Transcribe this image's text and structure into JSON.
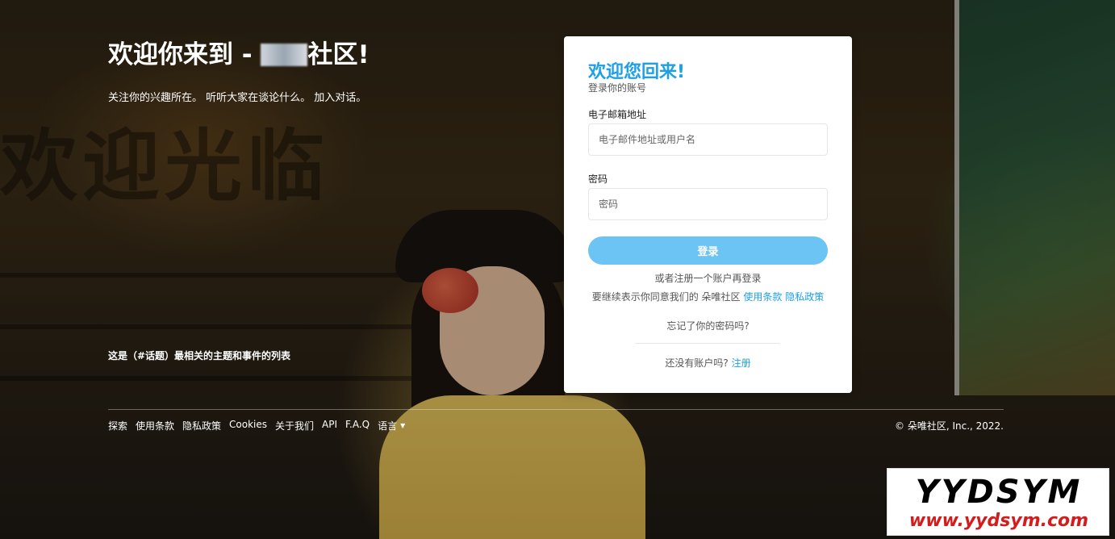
{
  "hero": {
    "title_prefix": "欢迎你来到 - ",
    "title_suffix": "社区!",
    "subtitle": "关注你的兴趣所在。 听听大家在谈论什么。 加入对话。",
    "topics": "这是（#话题）最相关的主题和事件的列表"
  },
  "background": {
    "sign_text": "欢迎光临"
  },
  "login": {
    "title": "欢迎您回来!",
    "subtitle": "登录你的账号",
    "email_label": "电子邮箱地址",
    "email_placeholder": "电子邮件地址或用户名",
    "password_label": "密码",
    "password_placeholder": "密码",
    "submit_label": "登录",
    "register_hint": "或者注册一个账户再登录",
    "terms_prefix": "要继续表示你同意我们的 朵唯社区",
    "terms_link": "使用条款",
    "privacy_link": "隐私政策",
    "forgot_password": "忘记了你的密码吗?",
    "no_account": "还没有账户吗?",
    "signup_link": "注册"
  },
  "footer": {
    "links": [
      "探索",
      "使用条款",
      "隐私政策",
      "Cookies",
      "关于我们",
      "API",
      "F.A.Q"
    ],
    "language": "语言",
    "copyright": "© 朵唯社区, Inc., 2022."
  },
  "watermark": {
    "brand": "YYDSYM",
    "url": "www.yydsym.com"
  },
  "colors": {
    "accent": "#1ea0e6",
    "button": "#6cc4f4",
    "watermark_url": "#d41c1c"
  }
}
